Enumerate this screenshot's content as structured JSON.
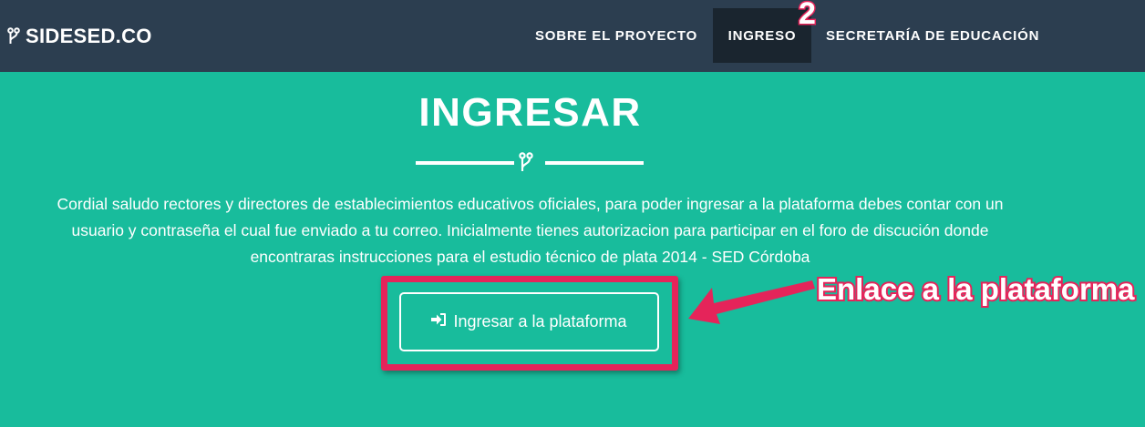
{
  "navbar": {
    "brand": "SIDESED.CO",
    "items": [
      {
        "label": "SOBRE EL PROYECTO"
      },
      {
        "label": "INGRESO"
      },
      {
        "label": "SECRETARÍA DE EDUCACIÓN"
      }
    ]
  },
  "annotations": {
    "step_number": "2",
    "link_callout": "Enlace a la plataforma"
  },
  "main": {
    "title": "INGRESAR",
    "intro_lines": [
      "Cordial saludo rectores y directores de establecimientos educativos oficiales, para poder ingresar a la plataforma debes contar con un",
      "usuario y contraseña el cual fue enviado a tu correo. Inicialmente tienes autorizacion para participar en el foro de discución donde",
      "encontraras instrucciones para el estudio técnico de plata 2014 - SED Córdoba"
    ],
    "login_button": "Ingresar a la plataforma"
  },
  "icons": {
    "brand": "branch-icon",
    "divider": "branch-icon",
    "login_button": "sign-in-icon"
  },
  "colors": {
    "navbar_bg": "#2c3e50",
    "active_nav_bg": "#1a252f",
    "main_bg": "#18bc9c",
    "annotation": "#e5245a"
  }
}
